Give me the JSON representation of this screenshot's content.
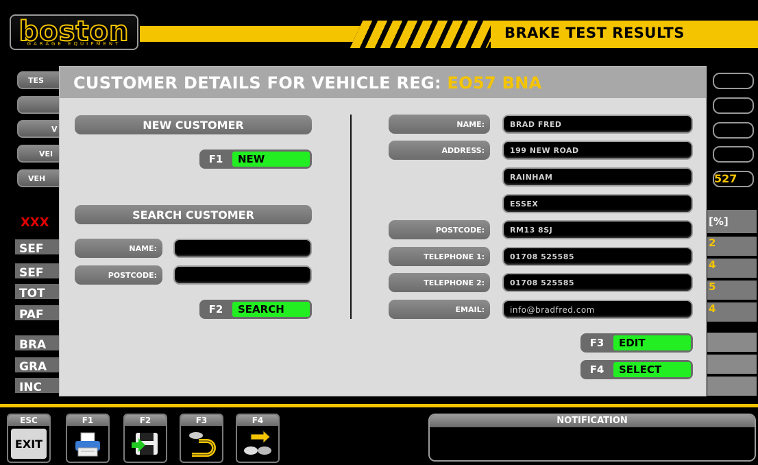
{
  "header": {
    "logo_text": "boston",
    "logo_sub": "GARAGE EQUIPMENT",
    "title": "BRAKE TEST RESULTS"
  },
  "background": {
    "left_labels": [
      "TES",
      "",
      "V",
      "VEI",
      "VEH"
    ],
    "rows": [
      "SEF",
      "SEF",
      "TOT",
      "PAF"
    ],
    "rows2": [
      "BRA",
      "GRA",
      "INC"
    ],
    "red_text": "XXX",
    "right_value": "527",
    "right_unit": "[%]",
    "right_vals": [
      "2",
      "4",
      "5",
      "4"
    ]
  },
  "modal": {
    "title_prefix": "CUSTOMER DETAILS FOR VEHICLE REG: ",
    "reg": "EO57 BNA",
    "new_customer": {
      "heading": "NEW CUSTOMER",
      "key": "F1",
      "button": "NEW"
    },
    "search_customer": {
      "heading": "SEARCH CUSTOMER",
      "name_label": "NAME:",
      "postcode_label": "POSTCODE:",
      "name_value": "",
      "postcode_value": "",
      "key": "F2",
      "button": "SEARCH"
    },
    "details": {
      "name_label": "NAME:",
      "name": "BRAD FRED",
      "address_label": "ADDRESS:",
      "address1": "199 NEW ROAD",
      "address2": "RAINHAM",
      "address3": "ESSEX",
      "postcode_label": "POSTCODE:",
      "postcode": "RM13 8SJ",
      "tel1_label": "TELEPHONE 1:",
      "tel1": "01708 525585",
      "tel2_label": "TELEPHONE 2:",
      "tel2": "01708 525585",
      "email_label": "EMAIL:",
      "email": "info@bradfred.com"
    },
    "edit": {
      "key": "F3",
      "button": "EDIT"
    },
    "select": {
      "key": "F4",
      "button": "SELECT"
    }
  },
  "footer": {
    "keys": [
      {
        "key": "ESC",
        "label": "EXIT",
        "icon": "exit"
      },
      {
        "key": "F1",
        "icon": "printer-icon"
      },
      {
        "key": "F2",
        "icon": "save-icon"
      },
      {
        "key": "F3",
        "icon": "return-icon"
      },
      {
        "key": "F4",
        "icon": "vehicle-transfer-icon"
      }
    ],
    "notification_title": "NOTIFICATION",
    "notification_text": ""
  },
  "colors": {
    "accent": "#f5c400",
    "button_green": "#22ee22",
    "modal_bg": "#dcdcdc"
  }
}
